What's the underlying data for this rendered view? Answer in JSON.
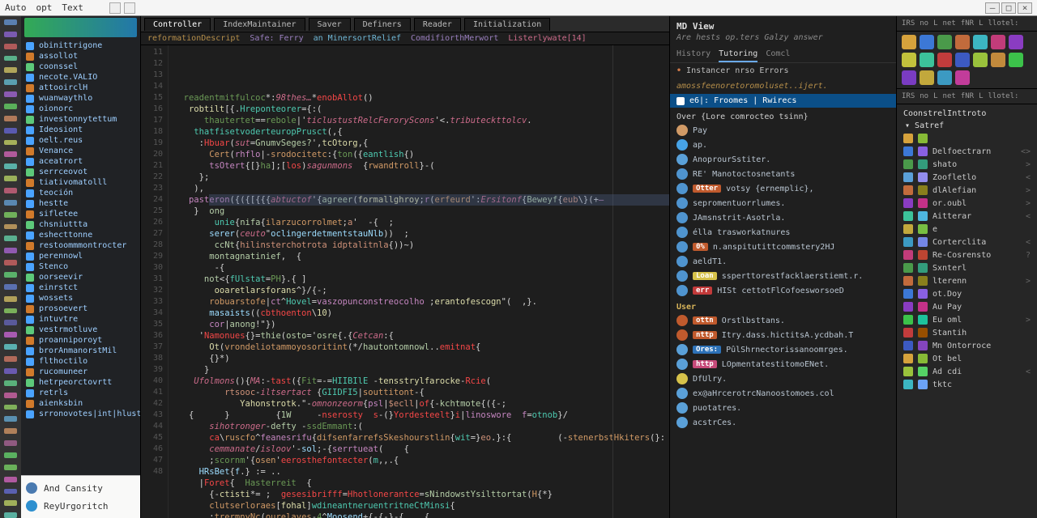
{
  "title_menu": {
    "file": "Auto",
    "edit": "opt",
    "text": "Text",
    "add": "+",
    "plus": "+"
  },
  "winbtns": {
    "min": "—",
    "max": "□",
    "close": "×"
  },
  "tabs": [
    "Controller",
    "IndexMaintainer",
    "Saver",
    "Definers",
    "Reader",
    "Initialization"
  ],
  "active_tab": "Controller",
  "crumbs": {
    "a": "reformationDescript",
    "b": "Safe: Ferry",
    "c": "an MinersortRelief",
    "d": "ComdifiorthMerwort",
    "e": "Listerlywate[14]"
  },
  "code_lines": [
    "  readentmitfulcoc*:98thes…*enobAllot()",
    "   robtilt[{.Hreponteorer={:(",
    "      thautertet==rebole|'ticlustustRelcFeroryScons'<.tributeckttolcv.",
    "    thatfisetvoderteuropPrusct(,{",
    "     :Hbuar(sut=GnumvSeges?',tcOtorg,{",
    "       Cert(rhflo|-srodocitetc:{ton({eantlish{)",
    "       tsOtert{[}ha];[los)sagunmons  {rwandtroll}-(",
    "     };",
    "    ),",
    "   pasteron({({[{{{abtuctof'{agreer(formallghroy;r(erfeurd':Ersitonf{Beweyf{eub\\}(+—",
    "    }  ong",
    "        unie{nifa{ilarzucorrolmet;a'  -{  ;",
    "       serer(ceuto\"oclingerdetmentstauNlb))  ;",
    "        ccNt{hilinsterchotrota idptalitnla{))~)",
    "       montagnatinief,  {",
    "        -{",
    "      not<{fUlstat=PH}.{ ]",
    "        ooaretlarsforans^}/{-;",
    "       robuarstofe|ct^Hovel=vaszopunconstreocolho ;erantofescogn\"(  ,}.",
    "       masaists((cbthoenton\\10)",
    "       cor|anong!\"})",
    "     'Namonues{}=thie(osto='osre{.{Cetcan:{",
    "       Ot(vrondeliotammoyosoritint(*/hautontomnowl..emitnat{",
    "       {}*)",
    "      }",
    "    Ufolmons(){MA:-tast({Fit=-=HIIBIlE -tensstrylfarocke-Rcie(                                       }",
    "          rtsooc-iltsertact {GIIDFI5|souttitont-{",
    "             Yahonstrotk.\"-omnonzeorm{psl|$ecll|of{-kchtmote{({-;",
    "   {      }         {1W     -nserosty  s-(}Yordesteelt}i|linoswore  f=otnob}/",
    "       sihotronger-defty -ssdEmmant:(",
    "       ca\\ruscfo^feanesrifu{difsenfarrefsSkeshourstlin{wit=}eo.}:{         (-stenerbstHkiters(}: .",
    "       cemmanate/isloov'-sol;-{serrtueat(    {",
    "       ;scornm'{osen'eerosthefontecter(m,,.{",
    "     HRsBet{f.} := ..",
    "     |Foret{  Hasterreit  {",
    "       {-ctisti*= ;  gesesibrifff=Hhotlonerantce=sNindowstYsilttortat(H{*}",
    "       clutserloraes[fohal]wdineantneruentritneCtMinsi{",
    "       :trermnyNc(ourelaves-4^Moosend+{-{-}-{    {"
  ],
  "panel": {
    "title": "MD View",
    "subtitle": "Are hests op.ters Galzy answer",
    "tabs": [
      "History",
      "Tutoring",
      "Comcl"
    ],
    "errlabel": "Instancer nrso Errors",
    "errline": "amossfeenoretoromoluset..ijert.",
    "scope": "e6|: Froomes | Rwirecs",
    "sect_title": "Over {Lore comrocteo tsinn}",
    "items": [
      {
        "color": "#d19a66",
        "badge": "",
        "name": "Pay"
      },
      {
        "color": "#47a3e6",
        "badge": "",
        "name": "ap."
      },
      {
        "color": "#5aa0d8",
        "badge": "",
        "name": "AnoprourSstiter."
      },
      {
        "color": "#4f94cf",
        "badge": "",
        "name": "RE' Manotoctosnetants"
      },
      {
        "color": "#4f94cf",
        "badge": "Otter",
        "bcol": "#c05a2d",
        "name": "votsy {ernemplic},"
      },
      {
        "color": "#4f94cf",
        "badge": "",
        "name": "sepromentuorrlumes."
      },
      {
        "color": "#4f94cf",
        "badge": "",
        "name": "JAmsnstrit-Asotrla."
      },
      {
        "color": "#4f94cf",
        "badge": "",
        "name": "élla trasworkatnures"
      },
      {
        "color": "#4f94cf",
        "badge": "0%",
        "bcol": "#c05a2d",
        "name": "n.anspitutittcommstery2HJ"
      },
      {
        "color": "#4f94cf",
        "badge": "",
        "name": "aeldT1."
      },
      {
        "color": "#4f94cf",
        "badge": "Loan",
        "bcol": "#d6c24a",
        "name": "ssperttorestfacklaerstiemt.r."
      },
      {
        "color": "#4f94cf",
        "badge": "err",
        "bcol": "#c23a3a",
        "name": "HISt cettotFlCofoesworsoeD"
      }
    ],
    "sub2": "User",
    "items2": [
      {
        "color": "#c05a2d",
        "badge": "ottn",
        "bcol": "#c05a2d",
        "name": "Orstlbsttans."
      },
      {
        "color": "#c05a2d",
        "badge": "nttp",
        "bcol": "#c05a2d",
        "name": "Itry.dass.hictitsA.ycdbah.T"
      },
      {
        "color": "#5aa0d8",
        "badge": "Ores:",
        "bcol": "#2d72b8",
        "name": "PûlShrnectorissanoomrges."
      },
      {
        "color": "#5aa0d8",
        "badge": "http",
        "bcol": "#c64a7a",
        "name": "LOpmentatestitomoENet."
      },
      {
        "color": "#d6c24a",
        "badge": "",
        "name": "DfUlry."
      },
      {
        "color": "#5aa0d8",
        "badge": "",
        "name": "ex@aHrcerotrcNanoostomoes.col"
      },
      {
        "color": "#5aa0d8",
        "badge": "",
        "name": "puotatres."
      },
      {
        "color": "#5aa0d8",
        "badge": "",
        "name": "acstrCes."
      }
    ]
  },
  "activity_colors": [
    "#5a7fb0",
    "#7a5ab0",
    "#b05a5a",
    "#5ab08a",
    "#b0a55a",
    "#5a9fb0",
    "#8a5ab0",
    "#5ab05a",
    "#b07a5a",
    "#5a5ab0",
    "#a5b05a",
    "#b05a9a",
    "#5ab0a8",
    "#9ab05a",
    "#b05a70",
    "#5a88b0",
    "#70b05a",
    "#b0905a",
    "#5ab090",
    "#905ab0",
    "#b05a5a",
    "#5ab06a",
    "#5a70b0",
    "#b0a05a",
    "#7ab05a",
    "#5a5a9a",
    "#a85ab0",
    "#5ab0b0",
    "#b06a5a",
    "#6a5ab0",
    "#5ab07a",
    "#b05a90",
    "#80b05a",
    "#5a90b0",
    "#b0805a",
    "#905a80",
    "#5ab060",
    "#6ab05a",
    "#b05aa0",
    "#5a60b0",
    "#a0b05a",
    "#5ab0a0"
  ],
  "explorer": [
    "obinittrigone",
    "assollot",
    "coonssel",
    "necote.VALIO",
    "attooirclH",
    "wuanwaythlo",
    "oionorc",
    "investonnytettum",
    "Ideosiont",
    "oelt.reus",
    "Venance",
    "aceatrort",
    "serrceovot",
    "tiativomatolll",
    "teoción",
    "hestte",
    "sifletee",
    "chsniuttta",
    "eshecttonne",
    "restoommmontrocter",
    "perennowl",
    "Stenco",
    "oorseevir",
    "einrstct",
    "wossets",
    "prosoevert",
    "intuvtre",
    "vestrmotluve",
    "proanniporoyt",
    "brorAnmanorstMil",
    "flthoctilo",
    "rucomuneer",
    "hetrpeorctovrtt",
    "retrls",
    "aienksbin",
    "srronovotes|int|hlustorrail"
  ],
  "popover": {
    "a": "And Cansity",
    "b": "ReyUrgoritch"
  },
  "rbox": {
    "strip": [
      "IRS",
      "no",
      "L",
      "net",
      "fNR",
      "L",
      "llotel:"
    ],
    "grid_colors": [
      "#d6a23c",
      "#3c78d6",
      "#4a9a4a",
      "#c26b3c",
      "#3cb6c2",
      "#c23c7a",
      "#8a3cc2",
      "#c2c23c",
      "#3cc29a",
      "#c23c3c",
      "#3c5ac2",
      "#9ac23c",
      "#c28a3c",
      "#3cc24a",
      "#7a3cc2",
      "#c2a83c",
      "#3c9ac2",
      "#c23c9a"
    ],
    "head": "CoonstrelInttroto",
    "satref": "Satref",
    "items": [
      {
        "c": "#d6a23c",
        "n": ""
      },
      {
        "c": "#3c78d6",
        "n": "Delfoectrarn",
        "chev": "<>"
      },
      {
        "c": "#4a9a4a",
        "n": "shato",
        "chev": ">"
      },
      {
        "c": "#5aa0d8",
        "n": "Zoofletlo",
        "chev": "<"
      },
      {
        "c": "#c26b3c",
        "n": "dlAlefian",
        "chev": ">"
      },
      {
        "c": "#8a3cc2",
        "n": "or.oubl",
        "chev": ">"
      },
      {
        "c": "#3cc29a",
        "n": "Aitterar",
        "chev": "<"
      },
      {
        "c": "#c2a83c",
        "n": "e"
      },
      {
        "c": "#3c9ac2",
        "n": "Corterclita",
        "chev": "<"
      },
      {
        "c": "#c23c7a",
        "n": "Re-Cosrensto",
        "chev": "?"
      },
      {
        "c": "#4a9a4a",
        "n": "Sxnterl"
      },
      {
        "c": "#c26b3c",
        "n": "lterenn",
        "chev": ">"
      },
      {
        "c": "#3c78d6",
        "n": "ot.Doy"
      },
      {
        "c": "#8a3cc2",
        "n": "Au Pay"
      },
      {
        "c": "#3cc24a",
        "n": "Eu oml",
        "chev": ">"
      },
      {
        "c": "#c23c3c",
        "n": "Stantih"
      },
      {
        "c": "#3c5ac2",
        "n": "Mn Ontorroce"
      },
      {
        "c": "#d6a23c",
        "n": "Ot bel"
      },
      {
        "c": "#9ac23c",
        "n": "Ad cdi",
        "chev": "<"
      },
      {
        "c": "#3cb6c2",
        "n": "tktc"
      }
    ]
  }
}
